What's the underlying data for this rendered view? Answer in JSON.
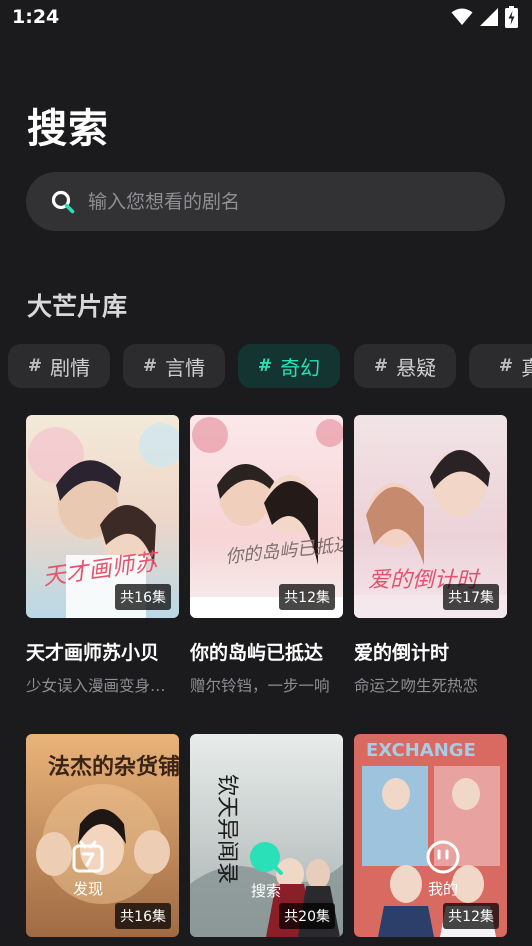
{
  "status_bar": {
    "time": "1:24"
  },
  "header": {
    "title": "搜索"
  },
  "search": {
    "placeholder": "输入您想看的剧名"
  },
  "library": {
    "title": "大芒片库",
    "genres": [
      {
        "label": "剧情",
        "active": false
      },
      {
        "label": "言情",
        "active": false
      },
      {
        "label": "奇幻",
        "active": true
      },
      {
        "label": "悬疑",
        "active": false
      },
      {
        "label": "真",
        "active": false
      }
    ],
    "dramas": [
      {
        "title": "天才画师苏小贝",
        "description": "少女误入漫画变身…",
        "episodes": "共16集",
        "poster_text": "天才画师苏"
      },
      {
        "title": "你的岛屿已抵达",
        "description": "赠尔铃铛，一步一响",
        "episodes": "共12集",
        "poster_text": "你的岛屿已抵达"
      },
      {
        "title": "爱的倒计时",
        "description": "命运之吻生死热恋",
        "episodes": "共17集",
        "poster_text": "爱的倒计时"
      },
      {
        "title": "",
        "description": "",
        "episodes": "共16集",
        "poster_text": "法杰的杂货铺"
      },
      {
        "title": "",
        "description": "",
        "episodes": "共20集",
        "poster_text": "钦天异闻录"
      },
      {
        "title": "",
        "description": "",
        "episodes": "共12集",
        "poster_text": "EXCHANGE"
      }
    ]
  },
  "bottom_nav": {
    "items": [
      {
        "label": "发现",
        "icon": "discover-icon",
        "active": false
      },
      {
        "label": "搜索",
        "icon": "search-icon",
        "active": true
      },
      {
        "label": "我的",
        "icon": "profile-icon",
        "active": false
      }
    ]
  },
  "colors": {
    "accent": "#2ae0b8",
    "background": "#1b1b1d",
    "chip_bg": "#2c2c2e",
    "search_bg": "#323234"
  }
}
